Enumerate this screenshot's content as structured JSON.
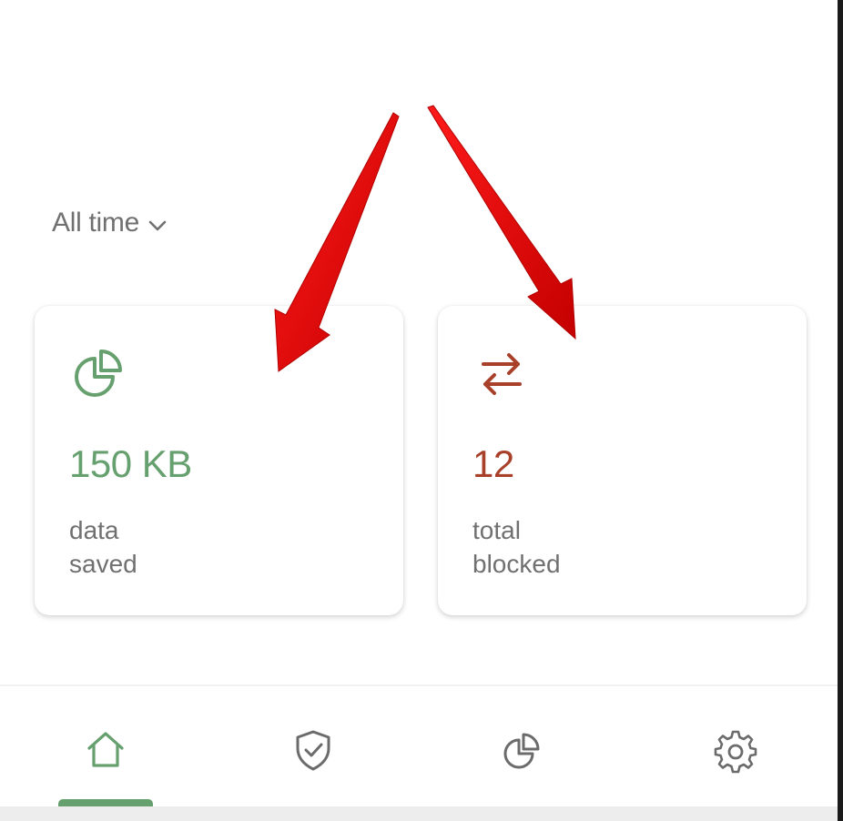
{
  "filter": {
    "label": "All time",
    "icon": "chevron-down-icon"
  },
  "stats": {
    "data_saved": {
      "value": "150 KB",
      "caption_line1": "data",
      "caption_line2": "saved",
      "icon": "pie-chart-icon",
      "color": "#67a06f"
    },
    "total_blocked": {
      "value": "12",
      "caption_line1": "total",
      "caption_line2": "blocked",
      "icon": "swap-arrows-icon",
      "color": "#a8402a"
    }
  },
  "nav": {
    "items": [
      {
        "name": "home",
        "icon": "home-icon",
        "active": true
      },
      {
        "name": "protection",
        "icon": "shield-check-icon",
        "active": false
      },
      {
        "name": "statistics",
        "icon": "pie-chart-icon",
        "active": false
      },
      {
        "name": "settings",
        "icon": "gear-icon",
        "active": false
      }
    ],
    "active_color": "#67a06f",
    "inactive_color": "#6b6b6b"
  },
  "annotation": {
    "arrow_color": "#e50000"
  }
}
